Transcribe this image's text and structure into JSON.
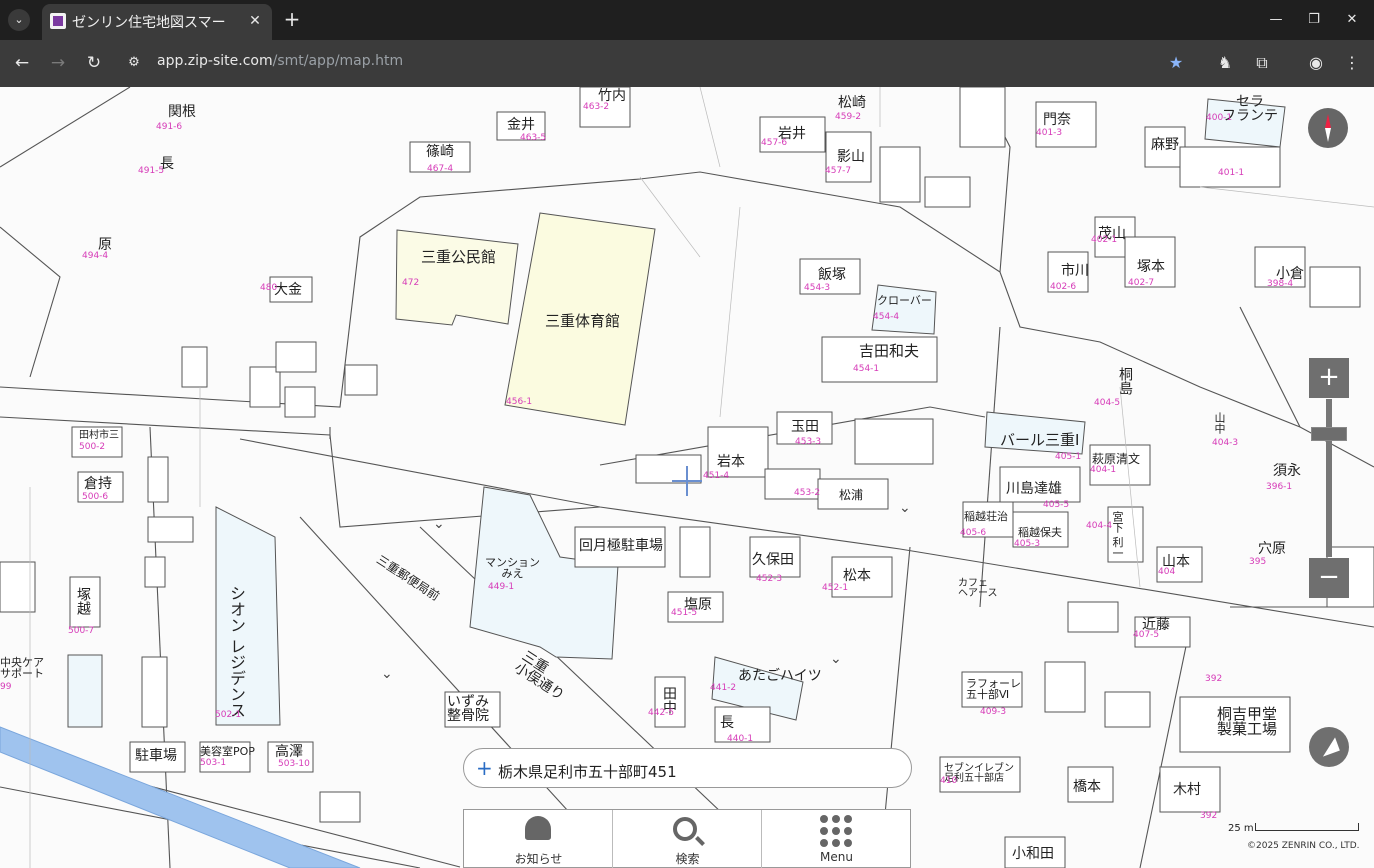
{
  "browser": {
    "tab_title": "ゼンリン住宅地図スマー",
    "url_host": "app.zip-site.com",
    "url_path": "/smt/app/map.htm"
  },
  "map": {
    "buildings": [
      {
        "name": "三重公民館",
        "lot": "472"
      },
      {
        "name": "三重体育館",
        "lot": "456-1"
      },
      {
        "name": "マンション\nみえ",
        "lot": "449-1"
      },
      {
        "name": "シオン\nレジデンス",
        "lot": "502-1"
      },
      {
        "name": "回月極駐車場"
      },
      {
        "name": "吉田和夫",
        "lot": "454-1"
      },
      {
        "name": "飯塚",
        "lot": "454-3"
      },
      {
        "name": "クローバー",
        "lot": "454-4"
      },
      {
        "name": "玉田",
        "lot": "453-3"
      },
      {
        "name": "岩本",
        "lot": "451-4"
      },
      {
        "name": "松浦",
        "lot": "453-2"
      },
      {
        "name": "久保田",
        "lot": "452-3"
      },
      {
        "name": "松本",
        "lot": "452-1"
      },
      {
        "name": "塩原",
        "lot": "451-5"
      },
      {
        "name": "あたごハイツ",
        "lot": "441-2"
      },
      {
        "name": "田中",
        "lot": "442-5"
      },
      {
        "name": "長",
        "lot": "440-1"
      },
      {
        "name": "バール三重Ⅰ",
        "lot": "405-1"
      },
      {
        "name": "萩原清文",
        "lot": "404-1"
      },
      {
        "name": "川島達雄",
        "lot": "405-5"
      },
      {
        "name": "山本",
        "lot": "404"
      },
      {
        "name": "近藤",
        "lot": "407-5"
      },
      {
        "name": "桐吉甲堂\n製菓工場",
        "lot": "392"
      },
      {
        "name": "木村",
        "lot": "392"
      },
      {
        "name": "橋本"
      },
      {
        "name": "小和田"
      },
      {
        "name": "岩井",
        "lot": "457-6"
      },
      {
        "name": "松崎",
        "lot": "459-2"
      },
      {
        "name": "影山",
        "lot": "457-7"
      },
      {
        "name": "金井",
        "lot": "463-5"
      },
      {
        "name": "篠崎",
        "lot": "467-4"
      },
      {
        "name": "竹内",
        "lot": "463-2"
      },
      {
        "name": "門奈",
        "lot": "401-3"
      },
      {
        "name": "麻野",
        "lot": "401-1"
      },
      {
        "name": "セラ\nフランテ",
        "lot": "400-1"
      },
      {
        "name": "茂山",
        "lot": "402-1"
      },
      {
        "name": "市川",
        "lot": "402-6"
      },
      {
        "name": "塚本",
        "lot": "402-7"
      },
      {
        "name": "小倉",
        "lot": "398-4"
      },
      {
        "name": "須永",
        "lot": "396-1"
      },
      {
        "name": "穴原",
        "lot": "395"
      },
      {
        "name": "大金",
        "lot": "480"
      },
      {
        "name": "関根",
        "lot": "491-6"
      },
      {
        "name": "倉持",
        "lot": "500-6"
      },
      {
        "name": "田村市三",
        "lot": "500-2"
      },
      {
        "name": "塚越",
        "lot": "500-7"
      },
      {
        "name": "駐車場"
      },
      {
        "name": "美容室POP",
        "lot": "503-1"
      },
      {
        "name": "高澤",
        "lot": "503-10"
      },
      {
        "name": "いずみ\n整骨院"
      },
      {
        "name": "中央ケア\nサポート",
        "lot": "99"
      },
      {
        "name": "三重郵便局前"
      },
      {
        "name": "三重\n小俣通り"
      },
      {
        "name": "セブンイレブン\n足利五十部店",
        "lot": "410"
      },
      {
        "name": "ラフォーレ\n五十部Ⅵ",
        "lot": "409-3"
      },
      {
        "name": "カフェ\nヘアース"
      },
      {
        "name": "宮下\n利一",
        "lot": "404-4"
      },
      {
        "name": "桐島",
        "lot": "404-5"
      },
      {
        "name": "山中",
        "lot": "404-3"
      },
      {
        "name": "稲越荘治",
        "lot": "405-6"
      },
      {
        "name": "稲越保夫",
        "lot": "405-3"
      },
      {
        "name": "原",
        "lot": "494-4"
      },
      {
        "name": "長",
        "lot": "491-5"
      }
    ],
    "search_address": "栃木県足利市五十部町451",
    "scale_label": "25 m",
    "copyright": "©2025 ZENRIN CO., LTD.",
    "controls": {
      "zoom_in": "+",
      "zoom_out": "−"
    }
  },
  "bottom_bar": {
    "notice": "お知らせ",
    "search": "検索",
    "menu": "Menu"
  },
  "icons": [
    "tab-list-icon",
    "close-icon",
    "new-tab-icon",
    "minimize-icon",
    "maximize-icon",
    "back-icon",
    "forward-icon",
    "reload-icon",
    "site-info-icon",
    "bookmark-star-icon",
    "incognito-extension-icon",
    "extensions-icon",
    "profile-icon",
    "more-menu-icon",
    "compass-icon",
    "locate-icon",
    "bell-icon",
    "search-icon",
    "grid-menu-icon"
  ]
}
